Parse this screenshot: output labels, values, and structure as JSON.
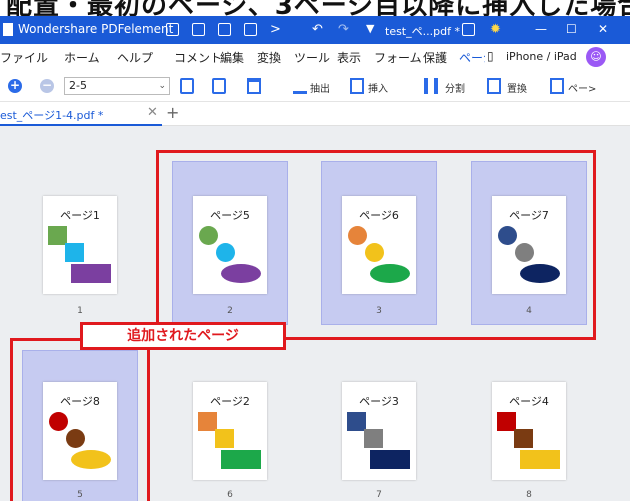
{
  "banner": {
    "text": "配置・最初のページ、3ページ目以降に挿入した場合"
  },
  "titlebar": {
    "app_name": "Wondershare PDFelement",
    "doc_name": "test_ペ...pdf *",
    "minimize": "—",
    "maximize": "☐",
    "close": "✕"
  },
  "menu": {
    "items": [
      "ファイル",
      "ホーム",
      "ヘルプ",
      "コメント",
      "編集",
      "変換",
      "ツール",
      "表示",
      "フォーム",
      "保護",
      "ページ"
    ],
    "device": "iPhone / iPad"
  },
  "toolbar": {
    "range_value": "2-5",
    "extract": "抽出",
    "insert": "挿入",
    "split": "分割",
    "replace": "置換",
    "more": "ペー>"
  },
  "tab": {
    "label": "est_ページ1-4.pdf *",
    "close": "✕",
    "add": "+"
  },
  "callout": "追加されたページ",
  "pages": [
    {
      "title": "ページ1",
      "number": "1",
      "selected": false
    },
    {
      "title": "ページ5",
      "number": "2",
      "selected": true
    },
    {
      "title": "ページ6",
      "number": "3",
      "selected": true
    },
    {
      "title": "ページ7",
      "number": "4",
      "selected": true
    },
    {
      "title": "ページ8",
      "number": "5",
      "selected": true
    },
    {
      "title": "ページ2",
      "number": "6",
      "selected": false
    },
    {
      "title": "ページ3",
      "number": "7",
      "selected": false
    },
    {
      "title": "ページ4",
      "number": "8",
      "selected": false
    }
  ],
  "colors": {
    "accent": "#1a5ad7",
    "selection": "#c6cbf1",
    "highlight_border": "#e0191e"
  }
}
